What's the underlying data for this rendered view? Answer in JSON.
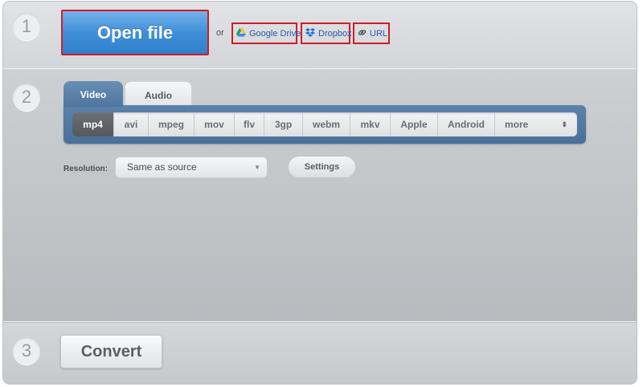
{
  "steps": {
    "one": "1",
    "two": "2",
    "three": "3"
  },
  "step1": {
    "open_file": "Open file",
    "or": "or",
    "google_drive": "Google Drive",
    "dropbox": "Dropbox",
    "url": "URL"
  },
  "step2": {
    "tabs": [
      {
        "label": "Video",
        "active": true
      },
      {
        "label": "Audio",
        "active": false
      }
    ],
    "formats": [
      "mp4",
      "avi",
      "mpeg",
      "mov",
      "flv",
      "3gp",
      "webm",
      "mkv",
      "Apple",
      "Android",
      "more"
    ],
    "selected_format": "mp4",
    "resolution_label": "Resolution:",
    "resolution_value": "Same as source",
    "settings": "Settings"
  },
  "step3": {
    "convert": "Convert"
  },
  "colors": {
    "accent_blue": "#3f8fd8",
    "highlight_red": "#d01c2a",
    "tab_blue": "#4f769f"
  },
  "icons": [
    "google-drive-icon",
    "dropbox-icon",
    "link-icon",
    "up-down-arrows-icon",
    "chevron-down-icon"
  ]
}
